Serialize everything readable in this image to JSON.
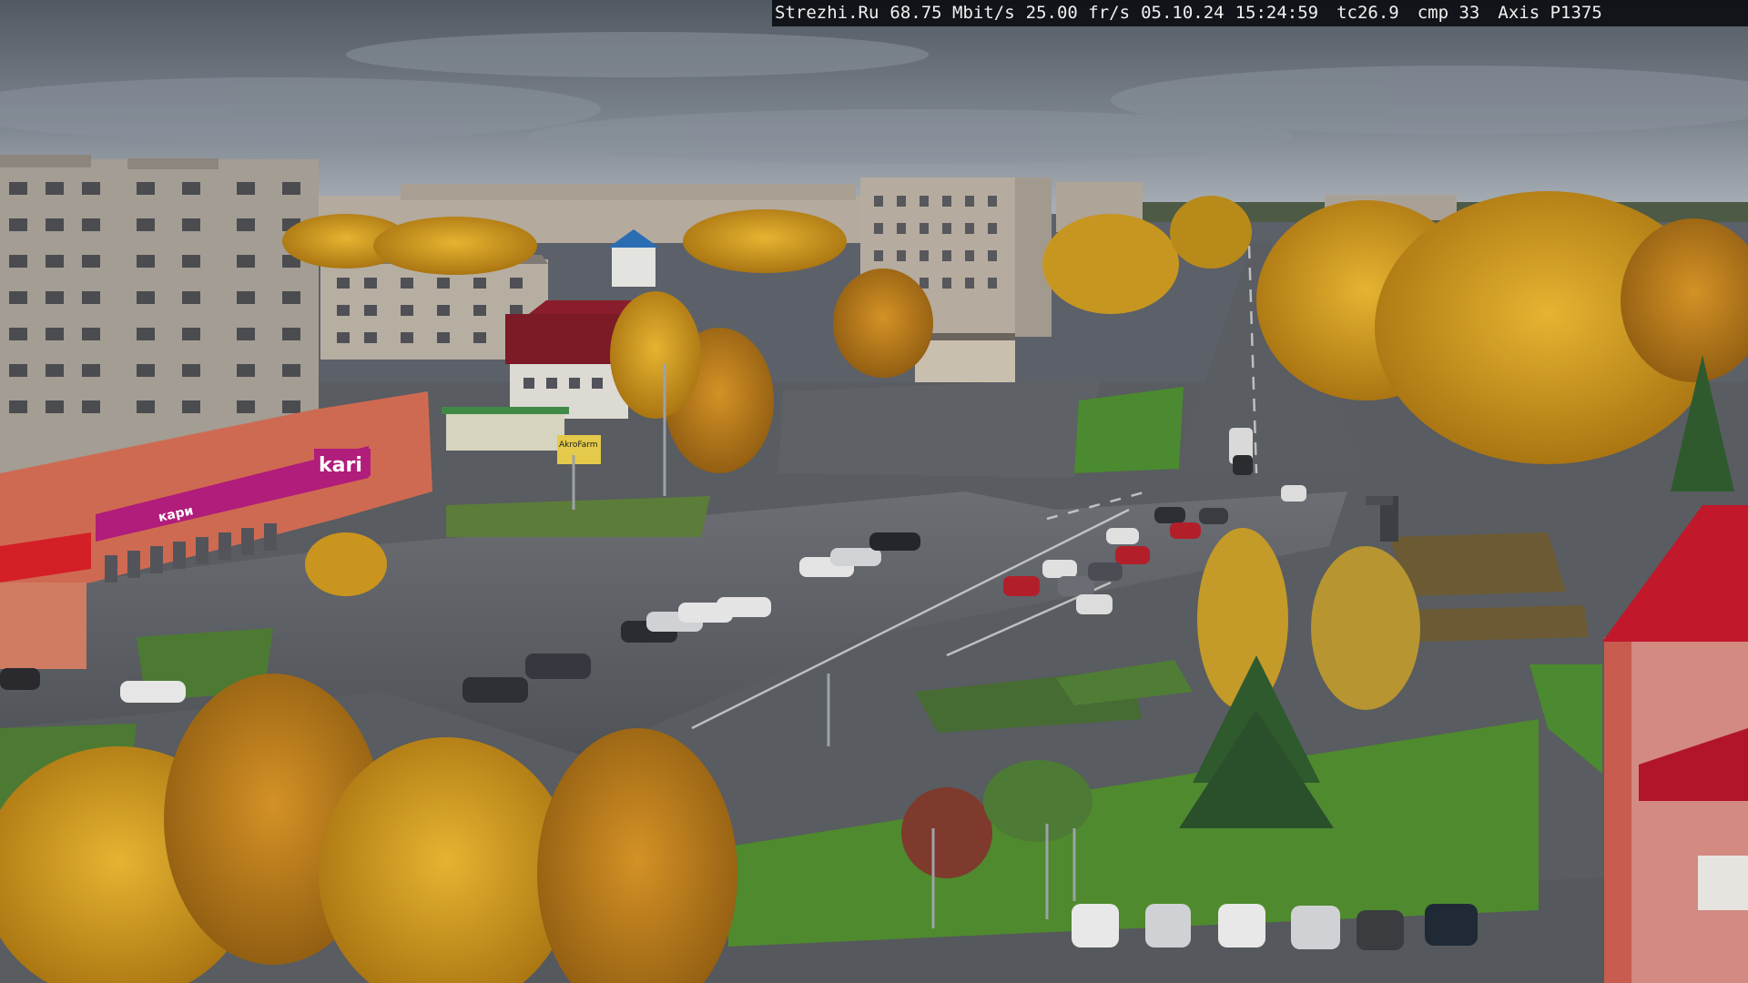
{
  "osd": {
    "site": "Strezhi.Ru",
    "bitrate": "68.75 Mbit/s",
    "framerate": "25.00 fr/s",
    "date": "05.10.24",
    "time": "15:24:59",
    "tc": "tc26.9",
    "cmp": "cmp 33",
    "camera": "Axis P1375"
  },
  "signs": {
    "store_logo": "kari",
    "store_banner": "кари",
    "ticker": "AkroFarm"
  },
  "palette": {
    "sky_top": "#5d6470",
    "sky_bottom": "#9aa3ad",
    "asphalt": "#55585d",
    "birch_yellow": "#d29a1a",
    "grass": "#4f8a2e",
    "kari_magenta": "#b01d7a",
    "roof_red": "#c2182b"
  }
}
